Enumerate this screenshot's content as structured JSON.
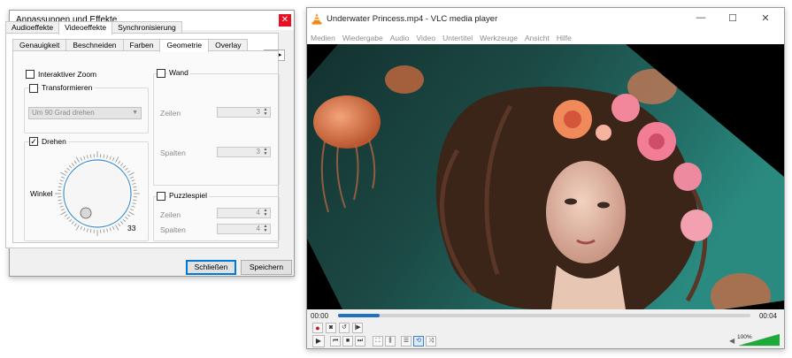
{
  "dialog": {
    "title": "Anpassungen und Effekte",
    "close_glyph": "✕",
    "outer_tabs": [
      "Audioeffekte",
      "Videoeffekte",
      "Synchronisierung"
    ],
    "active_outer_tab": "Videoeffekte",
    "inner_tabs": [
      "Genauigkeit",
      "Beschneiden",
      "Farben",
      "Geometrie",
      "Overlay"
    ],
    "active_inner_tab": "Geometrie",
    "tab_scroll_left": "◀",
    "tab_scroll_right": "▶",
    "interactive_zoom": {
      "label": "Interaktiver Zoom",
      "checked": false
    },
    "transform": {
      "label": "Transformieren",
      "checked": false,
      "combo_value": "Um 90 Grad drehen"
    },
    "rotate": {
      "label": "Drehen",
      "checked": true,
      "angle_label": "Winkel",
      "angle_value": "33"
    },
    "wall": {
      "label": "Wand",
      "checked": false,
      "rows_label": "Zeilen",
      "rows_value": "3",
      "cols_label": "Spalten",
      "cols_value": "3"
    },
    "puzzle": {
      "label": "Puzzlespiel",
      "checked": false,
      "rows_label": "Zeilen",
      "rows_value": "4",
      "cols_label": "Spalten",
      "cols_value": "4"
    },
    "close_button": "Schließen",
    "save_button": "Speichern"
  },
  "vlc": {
    "title": "Underwater Princess.mp4 - VLC media player",
    "window_controls": {
      "minimize": "—",
      "maximize": "☐",
      "close": "✕"
    },
    "menu": [
      "Medien",
      "Wiedergabe",
      "Audio",
      "Video",
      "Untertitel",
      "Werkzeuge",
      "Ansicht",
      "Hilfe"
    ],
    "time_elapsed": "00:00",
    "time_total": "00:04",
    "progress": 0.1,
    "volume_label": "100%",
    "volume_level": 1.0
  },
  "icons": {
    "record": "record-icon",
    "snapshot": "camera-icon",
    "loop_ab": "loop-ab-icon",
    "frame_step": "frame-step-icon",
    "play": "play-icon",
    "previous": "previous-icon",
    "stop": "stop-icon",
    "next": "next-icon",
    "fullscreen": "fullscreen-icon",
    "extended": "extended-settings-icon",
    "playlist": "playlist-icon",
    "loop": "loop-icon",
    "shuffle": "shuffle-icon",
    "volume": "speaker-icon"
  },
  "colors": {
    "accent": "#0078d7",
    "seek": "#1f6fc5",
    "volume": "#1aab38",
    "close_red": "#e81123"
  }
}
